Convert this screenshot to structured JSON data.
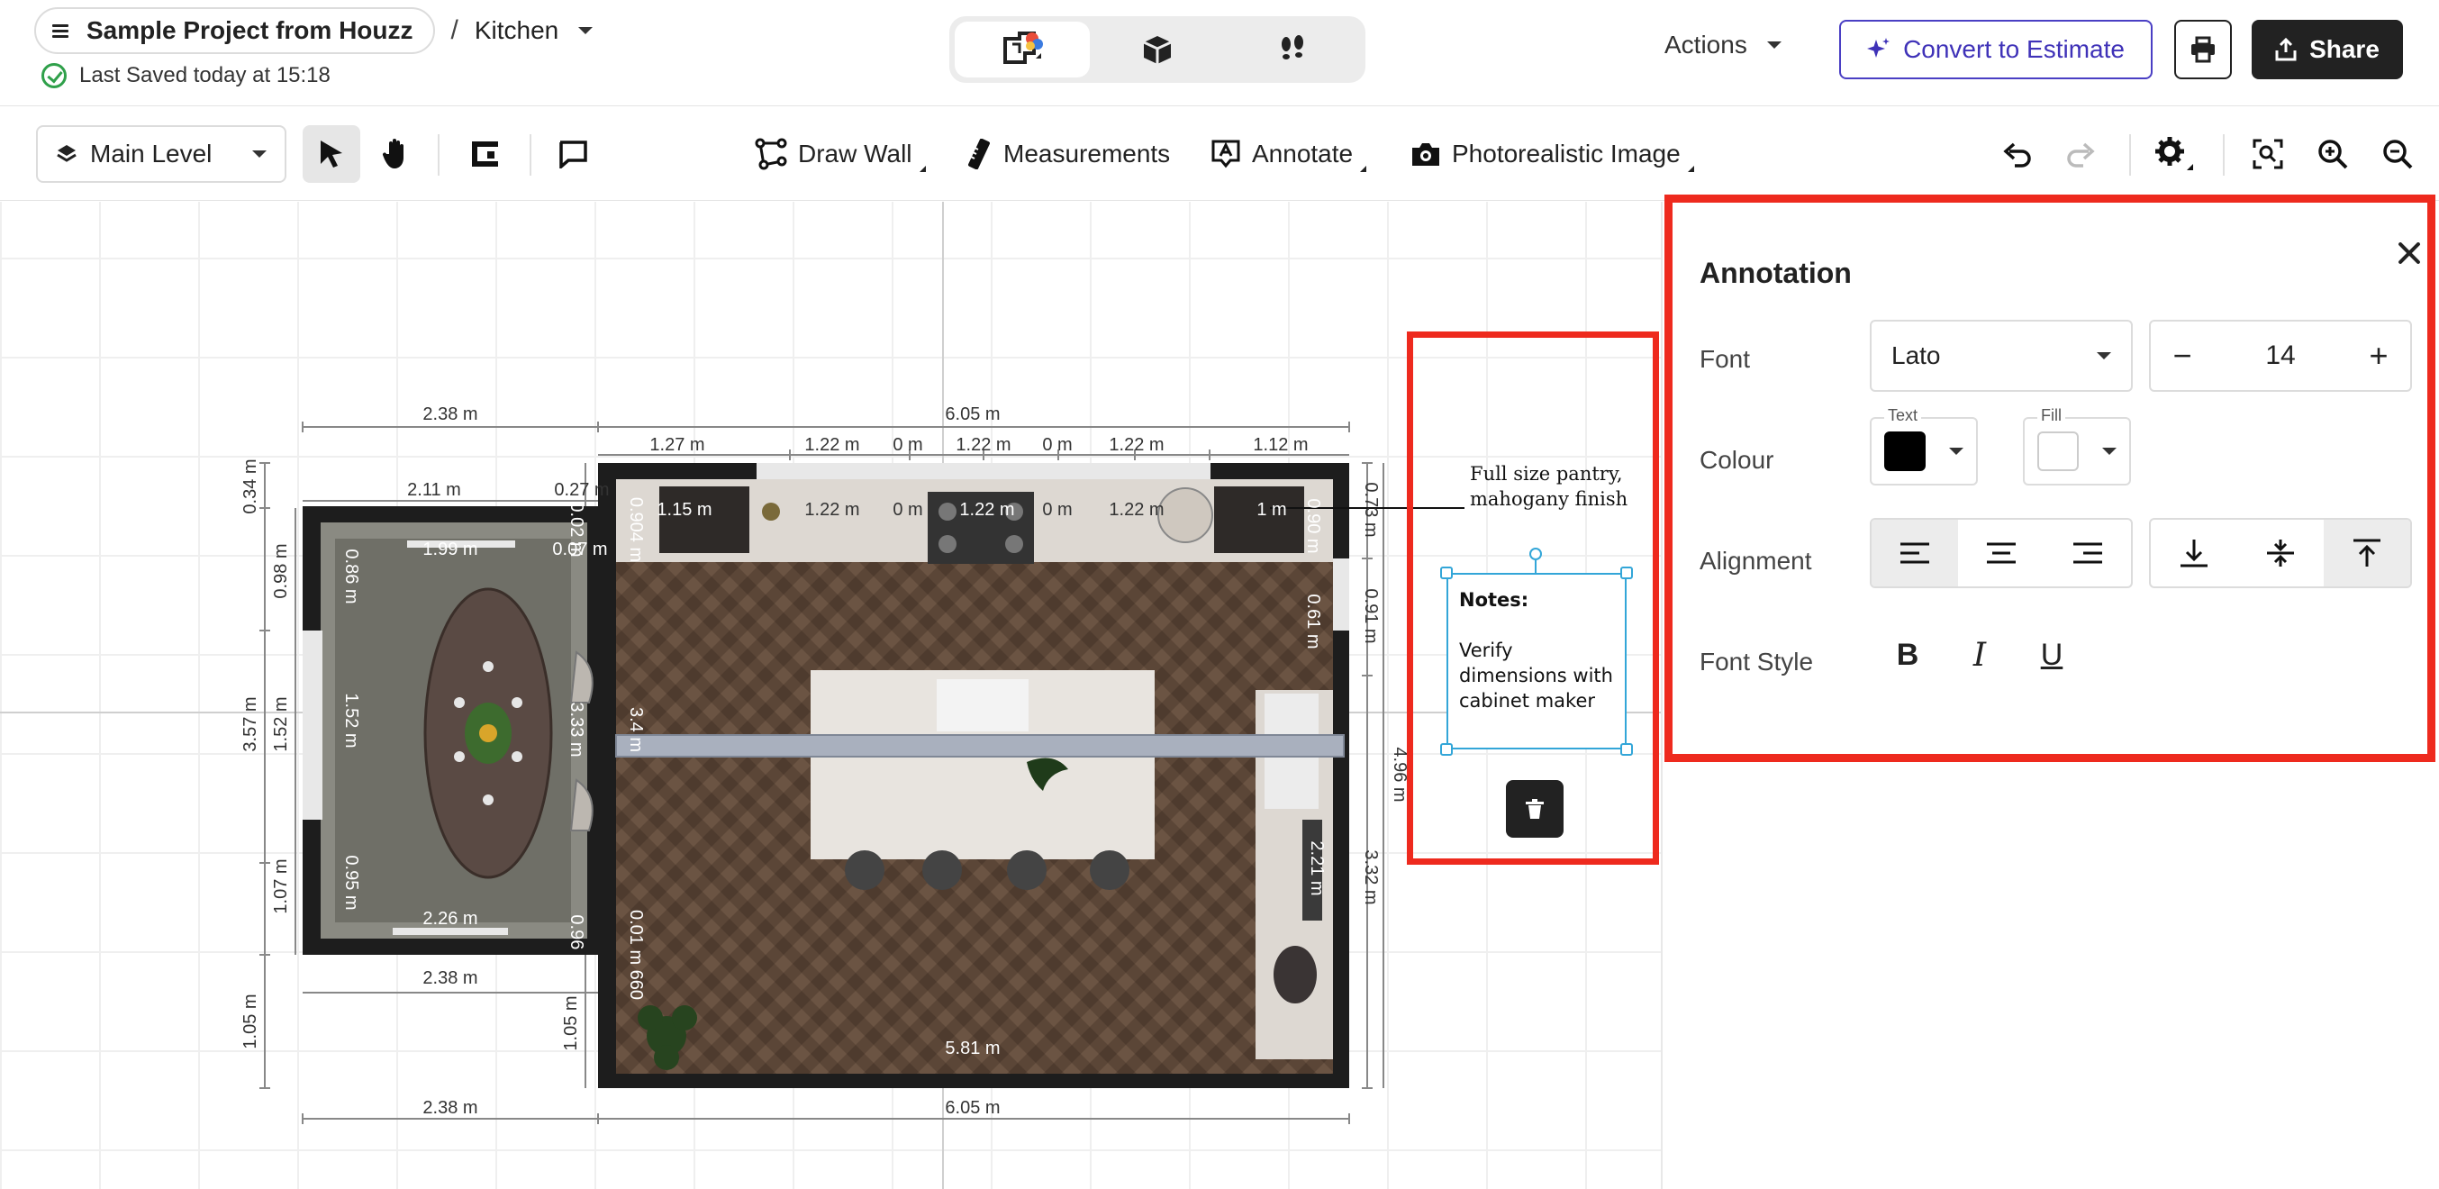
{
  "header": {
    "project_name": "Sample Project from Houzz",
    "separator": "/",
    "room_name": "Kitchen",
    "saved_status": "Last Saved today at 15:18",
    "actions_label": "Actions",
    "convert_label": "Convert to Estimate",
    "share_label": "Share",
    "view_modes": [
      "2d-plan-icon",
      "3d-box-icon",
      "walkthrough-footsteps-icon"
    ],
    "active_view_mode": "2d-plan-icon"
  },
  "toolbar": {
    "level": "Main Level",
    "draw_wall": "Draw Wall",
    "measurements": "Measurements",
    "annotate": "Annotate",
    "photorealistic": "Photorealistic Image"
  },
  "plan": {
    "dims": {
      "top_left_overall": "2.38 m",
      "top_overall": "6.05 m",
      "top_segments": [
        "1.27 m",
        "1.22 m",
        "0 m",
        "1.22 m",
        "0 m",
        "1.22 m",
        "1.12 m"
      ],
      "inner_top_segments": [
        "1.15 m",
        "1.22 m",
        "0 m",
        "1.22 m",
        "0 m",
        "1.22 m",
        "1 m"
      ],
      "dining_top": "2.11 m",
      "dining_top_small": "0.27 m",
      "dining_inner_top": "1.99 m",
      "dining_inner_small": "0.07 m",
      "left_top": "0.34 m",
      "left_upper": "0.98 m",
      "left_overall": "3.57 m",
      "left_mid": "1.52 m",
      "left_lower": "1.07 m",
      "left_bottom": "1.05 m",
      "dining_inner_left_upper": "0.86 m",
      "dining_inner_left_mid": "1.52 m",
      "dining_inner_left_lower": "0.95 m",
      "dining_inner_bottom": "2.26 m",
      "dining_bottom": "2.38 m",
      "bottom_left": "2.38 m",
      "bottom_overall": "6.05 m",
      "kitchen_inner_bottom": "5.81 m",
      "kitchen_inner_left_upper": "0.904 m",
      "kitchen_inner_left_mid": "3.4 m",
      "kitchen_inner_left_lower": "0.01 m 660",
      "dining_right_mid": "3.33 m",
      "dining_right_top": "0.02 m",
      "dining_right_bottom": "0.96 m",
      "mid_bottom": "1.05 m",
      "right_top": "0.73 m",
      "right_upper": "0.91 m",
      "right_overall": "4.96 m",
      "right_lower": "3.32 m",
      "kitchen_inner_right_top": "0.90 m",
      "kitchen_inner_right_upper": "0.61 m",
      "kitchen_inner_right_lower": "2.21 m"
    },
    "pantry_note": [
      "Full size pantry,",
      "mahogany finish"
    ],
    "annotation": {
      "title": "Notes:",
      "lines": [
        "Verify",
        "dimensions with",
        "cabinet maker"
      ]
    }
  },
  "panel": {
    "title": "Annotation",
    "font_label": "Font",
    "font_value": "Lato",
    "font_size": "14",
    "minus": "−",
    "plus": "+",
    "colour_label": "Colour",
    "text_tag": "Text",
    "fill_tag": "Fill",
    "text_colour": "#000000",
    "fill_colour": "#ffffff",
    "alignment_label": "Alignment",
    "horizontal_align_selected": "left",
    "vertical_align_selected": "top",
    "font_style_label": "Font Style",
    "bold": "B",
    "italic": "I",
    "underline": "U"
  },
  "colors": {
    "accent_purple": "#3f32b8",
    "highlight_red": "#ee2a1e",
    "selection_blue": "#33a6d8",
    "saved_green": "#2fa04a"
  }
}
